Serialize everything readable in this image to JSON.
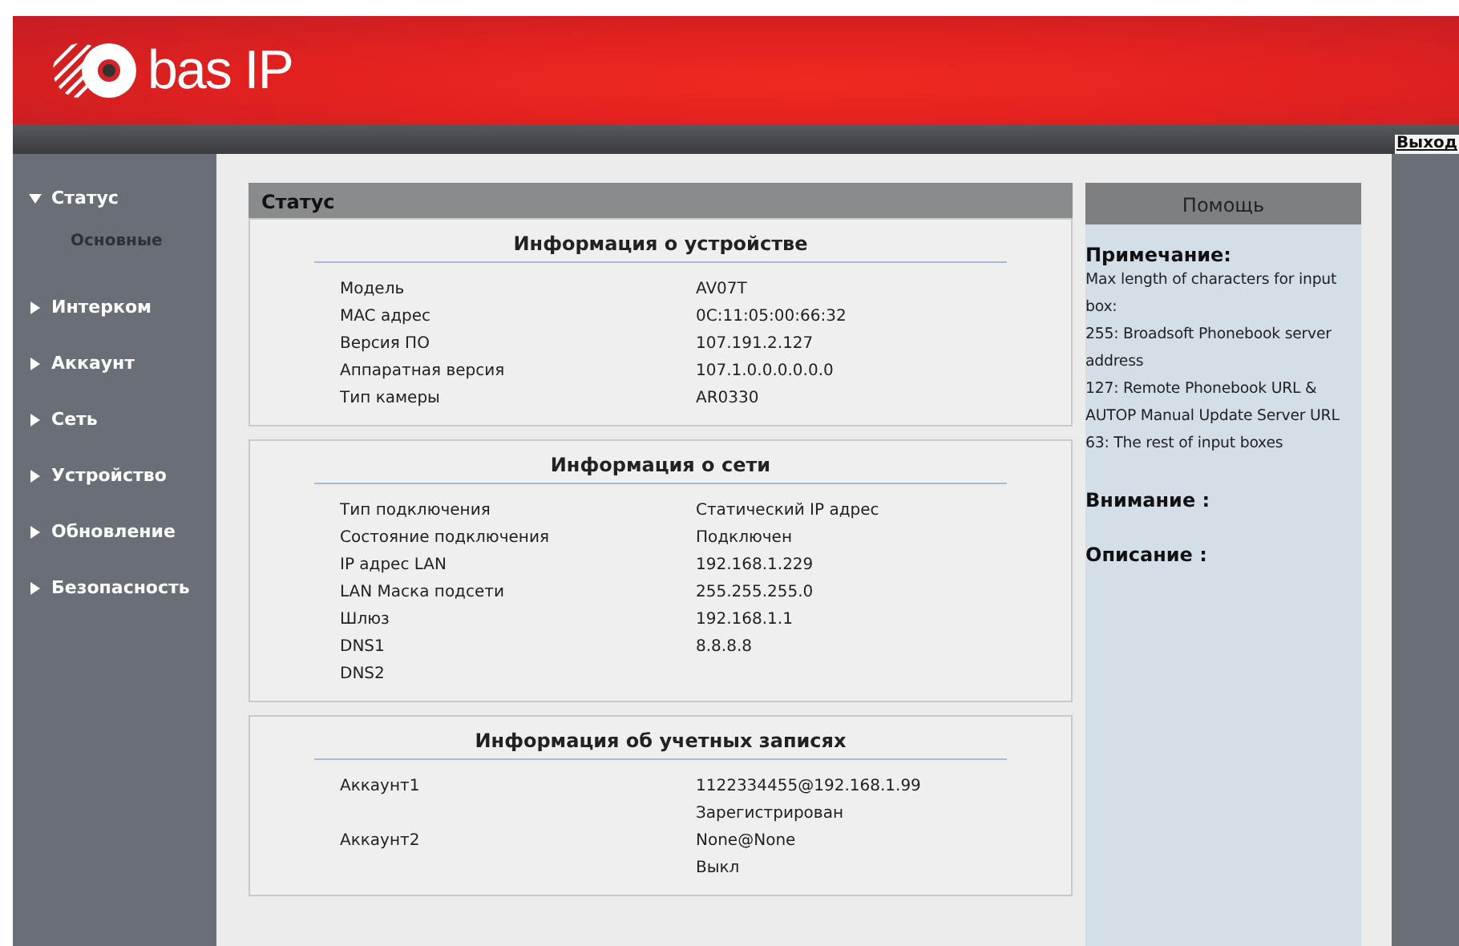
{
  "header": {
    "logo_text": "bas IP",
    "logout": "Выход"
  },
  "sidebar": {
    "items": [
      {
        "label": "Статус",
        "expanded": true,
        "children": [
          {
            "label": "Основные",
            "selected": true
          }
        ]
      },
      {
        "label": "Интерком",
        "expanded": false
      },
      {
        "label": "Аккаунт",
        "expanded": false
      },
      {
        "label": "Сеть",
        "expanded": false
      },
      {
        "label": "Устройство",
        "expanded": false
      },
      {
        "label": "Обновление",
        "expanded": false
      },
      {
        "label": "Безопасность",
        "expanded": false
      }
    ]
  },
  "panel": {
    "title": "Статус",
    "sections": [
      {
        "title": "Информация о устройстве",
        "rows": [
          {
            "label": "Модель",
            "value": "AV07T"
          },
          {
            "label": "MAC адрес",
            "value": "0C:11:05:00:66:32"
          },
          {
            "label": "Версия ПО",
            "value": "107.191.2.127"
          },
          {
            "label": "Аппаратная версия",
            "value": "107.1.0.0.0.0.0.0"
          },
          {
            "label": "Тип камеры",
            "value": "AR0330"
          }
        ]
      },
      {
        "title": "Информация о сети",
        "rows": [
          {
            "label": "Тип подключения",
            "value": "Статический IP адрес"
          },
          {
            "label": "Состояние подключения",
            "value": "Подключен"
          },
          {
            "label": "IP адрес LAN",
            "value": "192.168.1.229"
          },
          {
            "label": "LAN Маска подсети",
            "value": "255.255.255.0"
          },
          {
            "label": "Шлюз",
            "value": "192.168.1.1"
          },
          {
            "label": "DNS1",
            "value": "8.8.8.8"
          },
          {
            "label": "DNS2"
          }
        ]
      },
      {
        "title": "Информация об учетных записях",
        "rows": [
          {
            "label": "Аккаунт1",
            "value": "1122334455@192.168.1.99"
          },
          {
            "value": "Зарегистрирован"
          },
          {
            "label": "Аккаунт2",
            "value": "None@None"
          },
          {
            "value": "Выкл"
          }
        ]
      }
    ]
  },
  "help": {
    "title": "Помощь",
    "note_heading": "Примечание:",
    "note_lines": [
      "Max length of characters for input box:",
      "255: Broadsoft Phonebook server address",
      "127: Remote Phonebook URL & AUTOP Manual Update Server URL",
      "63: The rest of input boxes"
    ],
    "warning_heading": "Внимание :",
    "description_heading": "Описание :"
  }
}
